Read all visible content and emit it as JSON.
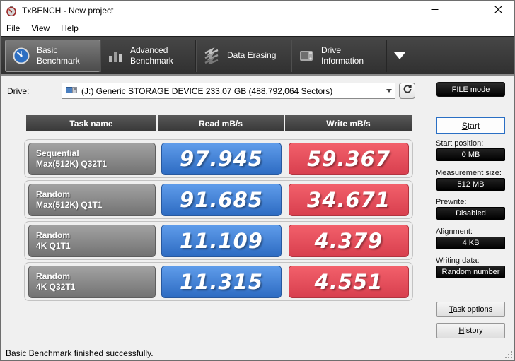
{
  "window": {
    "title": "TxBENCH - New project"
  },
  "menu": {
    "items": [
      {
        "label": "File"
      },
      {
        "label": "View"
      },
      {
        "label": "Help"
      }
    ]
  },
  "toolbar": {
    "tabs": [
      {
        "line1": "Basic",
        "line2": "Benchmark",
        "selected": true,
        "icon": "gauge-icon"
      },
      {
        "line1": "Advanced",
        "line2": "Benchmark",
        "selected": false,
        "icon": "bar-chart-icon"
      },
      {
        "line1": "Data Erasing",
        "line2": "",
        "selected": false,
        "icon": "erase-icon"
      },
      {
        "line1": "Drive",
        "line2": "Information",
        "selected": false,
        "icon": "drive-info-icon"
      }
    ]
  },
  "drive_row": {
    "label": "Drive:",
    "selected_value": "(J:) Generic STORAGE DEVICE 233.07 GB (488,792,064 Sectors)",
    "file_mode_label": "FILE mode"
  },
  "table": {
    "headers": [
      "Task name",
      "Read mB/s",
      "Write mB/s"
    ],
    "rows": [
      {
        "task_line1": "Sequential",
        "task_line2": "Max(512K) Q32T1",
        "read": "97.945",
        "write": "59.367"
      },
      {
        "task_line1": "Random",
        "task_line2": "Max(512K) Q1T1",
        "read": "91.685",
        "write": "34.671"
      },
      {
        "task_line1": "Random",
        "task_line2": "4K Q1T1",
        "read": "11.109",
        "write": "4.379"
      },
      {
        "task_line1": "Random",
        "task_line2": "4K Q32T1",
        "read": "11.315",
        "write": "4.551"
      }
    ]
  },
  "sidebar": {
    "start_button": "Start",
    "fields": [
      {
        "label": "Start position:",
        "value": "0 MB"
      },
      {
        "label": "Measurement size:",
        "value": "512 MB"
      },
      {
        "label": "Prewrite:",
        "value": "Disabled"
      },
      {
        "label": "Alignment:",
        "value": "4 KB"
      },
      {
        "label": "Writing data:",
        "value": "Random number"
      }
    ],
    "task_options_button": "Task options",
    "history_button": "History"
  },
  "status_bar": {
    "message": "Basic Benchmark finished successfully."
  },
  "colors": {
    "read_cell": "#3d7edb",
    "write_cell": "#e8505e",
    "task_cell": "#8a8a8a",
    "toolbar_bg": "#3b3b3b",
    "value_field_bg": "#000000",
    "start_button_border": "#2a6fc4"
  },
  "icons": [
    "app-icon",
    "minimize-icon",
    "maximize-icon",
    "close-icon",
    "gauge-icon",
    "bar-chart-icon",
    "erase-icon",
    "drive-info-icon",
    "storage-drive-icon",
    "chevron-down-icon",
    "refresh-icon",
    "overflow-caret-icon",
    "resize-grip-icon"
  ]
}
